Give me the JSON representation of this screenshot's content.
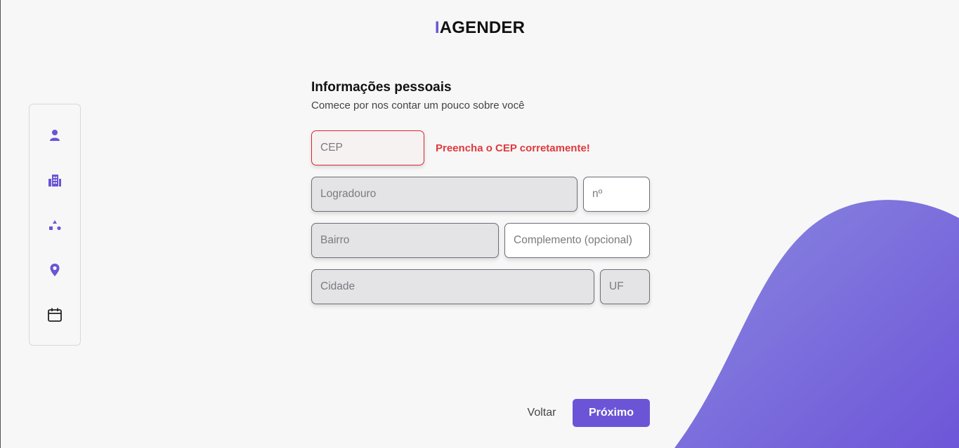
{
  "brand": {
    "logo_accent": "I",
    "logo_rest": "AGENDER"
  },
  "colors": {
    "accent": "#6b55d6",
    "error": "#e0393d",
    "wave_light": "#8a88e0",
    "wave_dark": "#6e56d8"
  },
  "stepper": {
    "steps": [
      {
        "icon": "person-icon",
        "state": "active"
      },
      {
        "icon": "building-icon",
        "state": "active"
      },
      {
        "icon": "shapes-icon",
        "state": "active"
      },
      {
        "icon": "location-pin-icon",
        "state": "active"
      },
      {
        "icon": "calendar-icon",
        "state": "inactive"
      }
    ]
  },
  "form": {
    "title": "Informações pessoais",
    "subtitle": "Comece por nos contar um pouco sobre você",
    "cep": {
      "placeholder": "CEP",
      "error": "Preencha o CEP corretamente!"
    },
    "logradouro": {
      "placeholder": "Logradouro"
    },
    "numero": {
      "placeholder": "nº"
    },
    "bairro": {
      "placeholder": "Bairro"
    },
    "complemento": {
      "placeholder": "Complemento (opcional)"
    },
    "cidade": {
      "placeholder": "Cidade"
    },
    "uf": {
      "placeholder": "UF"
    }
  },
  "actions": {
    "back_label": "Voltar",
    "next_label": "Próximo"
  }
}
